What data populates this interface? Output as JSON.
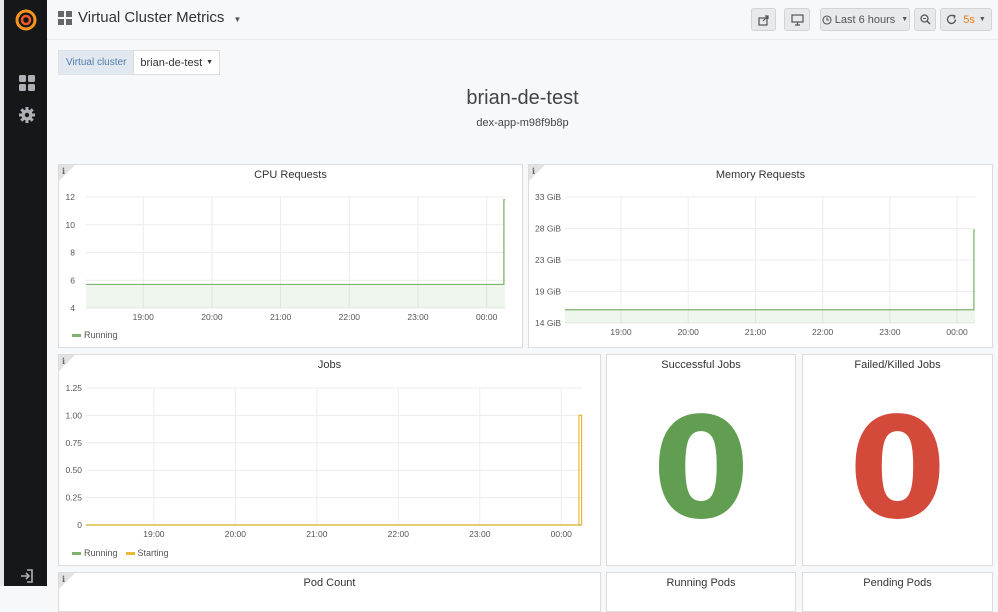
{
  "navbar": {
    "title": "Virtual Cluster Metrics",
    "time_range": "Last 6 hours",
    "refresh": "5s"
  },
  "variables": {
    "label": "Virtual cluster",
    "value": "brian-de-test"
  },
  "header": {
    "title": "brian-de-test",
    "subtitle": "dex-app-m98f9b8p"
  },
  "colors": {
    "green": "#7eb26d",
    "orange": "#eab839",
    "stat_green": "#629e51",
    "stat_red": "#d44a3a",
    "refresh_orange": "#eb7b18"
  },
  "panels": {
    "cpu": {
      "title": "CPU Requests",
      "legend": [
        "Running"
      ]
    },
    "memory": {
      "title": "Memory Requests"
    },
    "jobs": {
      "title": "Jobs",
      "legend": [
        "Running",
        "Starting"
      ]
    },
    "successful": {
      "title": "Successful Jobs",
      "value": "0"
    },
    "failed": {
      "title": "Failed/Killed Jobs",
      "value": "0"
    },
    "pod_count": {
      "title": "Pod Count"
    },
    "running_pods": {
      "title": "Running Pods"
    },
    "pending_pods": {
      "title": "Pending Pods"
    }
  },
  "chart_data": [
    {
      "type": "area",
      "title": "CPU Requests",
      "x_ticks": [
        "19:00",
        "20:00",
        "21:00",
        "22:00",
        "23:00",
        "00:00"
      ],
      "y_ticks": [
        "4",
        "6",
        "8",
        "10",
        "12"
      ],
      "ylim": [
        4,
        12
      ],
      "series": [
        {
          "name": "Running",
          "color": "#7eb26d",
          "x": [
            "18:10",
            "00:15",
            "00:15",
            "00:16"
          ],
          "values": [
            5.7,
            5.7,
            11.8,
            11.8
          ]
        }
      ]
    },
    {
      "type": "area",
      "title": "Memory Requests",
      "x_ticks": [
        "19:00",
        "20:00",
        "21:00",
        "22:00",
        "23:00",
        "00:00"
      ],
      "y_ticks": [
        "14 GiB",
        "19 GiB",
        "23 GiB",
        "28 GiB",
        "33 GiB"
      ],
      "ylim": [
        14,
        33
      ],
      "series": [
        {
          "name": "Running",
          "color": "#7eb26d",
          "x": [
            "18:10",
            "00:15",
            "00:15",
            "00:16"
          ],
          "values": [
            16,
            16,
            28,
            28
          ]
        }
      ]
    },
    {
      "type": "line",
      "title": "Jobs",
      "x_ticks": [
        "19:00",
        "20:00",
        "21:00",
        "22:00",
        "23:00",
        "00:00"
      ],
      "y_ticks": [
        "0",
        "0.25",
        "0.50",
        "0.75",
        "1.00",
        "1.25"
      ],
      "ylim": [
        0,
        1.25
      ],
      "series": [
        {
          "name": "Running",
          "color": "#7eb26d",
          "x": [
            "18:10",
            "00:15"
          ],
          "values": [
            0,
            0
          ]
        },
        {
          "name": "Starting",
          "color": "#eab839",
          "x": [
            "18:10",
            "00:13",
            "00:13",
            "00:15",
            "00:15"
          ],
          "values": [
            0,
            0,
            1,
            1,
            0
          ]
        }
      ]
    }
  ]
}
